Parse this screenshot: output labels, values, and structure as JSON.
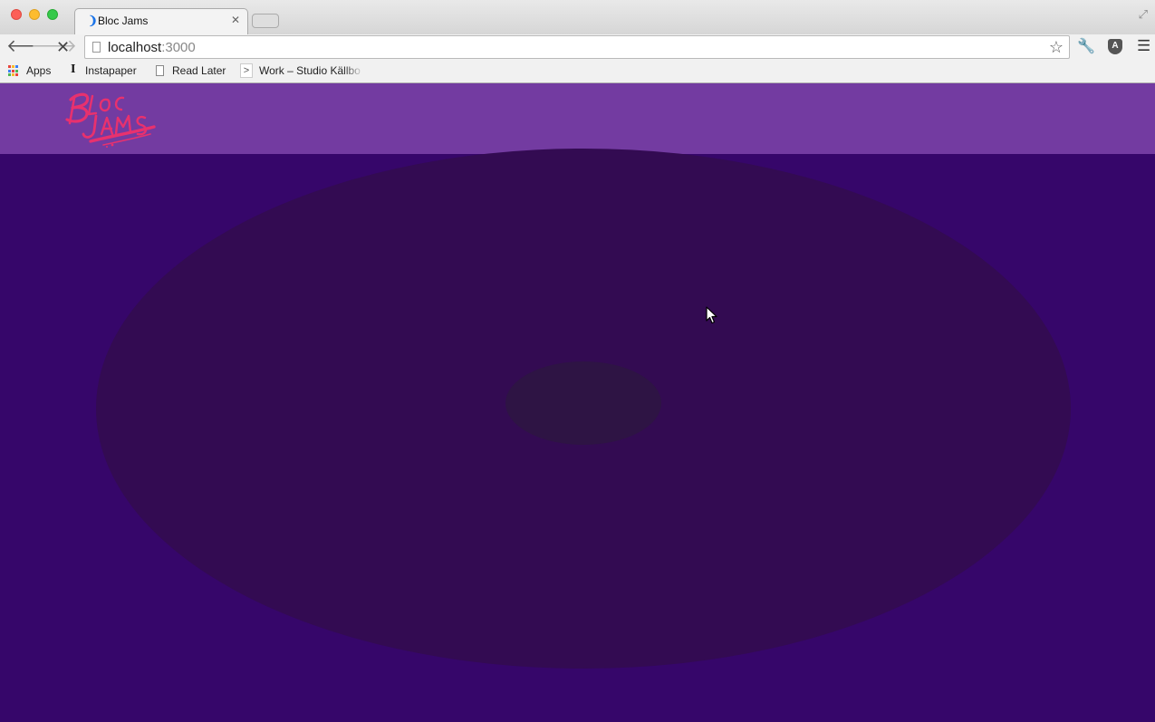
{
  "browser": {
    "tab": {
      "title": "Bloc Jams",
      "favicon": "bloc-favicon"
    },
    "omnibox": {
      "host": "localhost",
      "port": ":3000"
    },
    "bookmarks": [
      {
        "label": "Apps",
        "icon": "apps-icon"
      },
      {
        "label": "Instapaper",
        "icon": "instapaper-icon"
      },
      {
        "label": "Read Later",
        "icon": "document-icon"
      },
      {
        "label": "Work – Studio Källbo",
        "icon": "chevron-icon"
      }
    ]
  },
  "page": {
    "brand": {
      "logo_text": "Bloc Jams",
      "logo_color": "#e8316e"
    },
    "colors": {
      "navbar": "#733ba1",
      "background": "#36066a",
      "disc": "#330b52",
      "disc_center": "#2e1444"
    }
  }
}
